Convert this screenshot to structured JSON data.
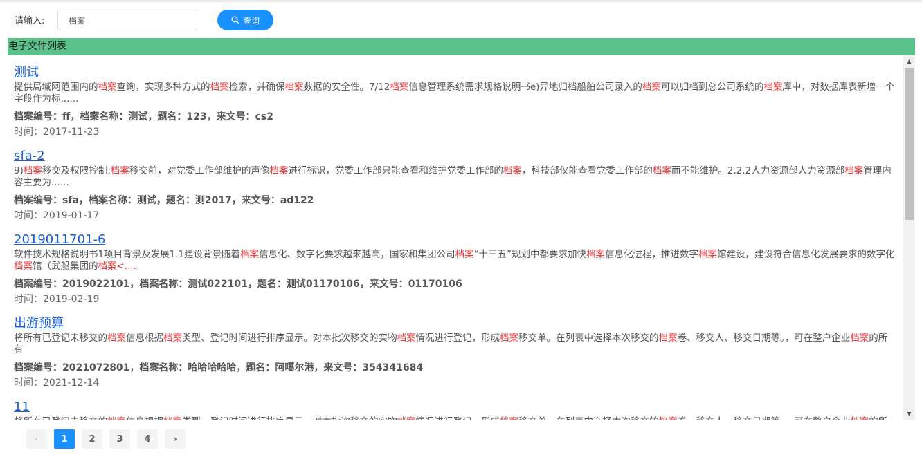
{
  "search": {
    "label": "请输入:",
    "value": "档案",
    "button_label": "查询"
  },
  "list": {
    "header": "电子文件列表",
    "items": [
      {
        "title": "测试",
        "snippet": [
          {
            "t": "提供局域网范围内的"
          },
          {
            "t": "档案",
            "hl": true
          },
          {
            "t": "查询，实现多种方式的"
          },
          {
            "t": "档案",
            "hl": true
          },
          {
            "t": "检索，并确保"
          },
          {
            "t": "档案",
            "hl": true
          },
          {
            "t": "数据的安全性。7/12"
          },
          {
            "t": "档案",
            "hl": true
          },
          {
            "t": "信息管理系统需求规格说明书e)异地归档船舶公司录入的"
          },
          {
            "t": "档案",
            "hl": true
          },
          {
            "t": "可以归档到总公司系统的"
          },
          {
            "t": "档案",
            "hl": true
          },
          {
            "t": "库中，对数据库表新增一个字段作为标......"
          }
        ],
        "meta": "档案编号：ff，档案名称：测试，题名：123，来文号：cs2",
        "time": "时间：2017-11-23"
      },
      {
        "title": "sfa-2",
        "snippet": [
          {
            "t": "9)"
          },
          {
            "t": "档案",
            "hl": true
          },
          {
            "t": "移交及权限控制:"
          },
          {
            "t": "档案",
            "hl": true
          },
          {
            "t": "移交前，对党委工作部维护的声像"
          },
          {
            "t": "档案",
            "hl": true
          },
          {
            "t": "进行标识，党委工作部只能查看和维护党委工作部的"
          },
          {
            "t": "档案",
            "hl": true
          },
          {
            "t": "，科技部仅能查看党委工作部的"
          },
          {
            "t": "档案",
            "hl": true
          },
          {
            "t": "而不能维护。2.2.2人力资源部人力资源部"
          },
          {
            "t": "档案",
            "hl": true
          },
          {
            "t": "管理内容主要为......"
          }
        ],
        "meta": "档案编号：sfa，档案名称：测试，题名：测2017，来文号：ad122",
        "time": "时间：2019-01-17"
      },
      {
        "title": "2019011701-6",
        "snippet": [
          {
            "t": "软件技术规格说明书1项目背景及发展1.1建设背景随着"
          },
          {
            "t": "档案",
            "hl": true
          },
          {
            "t": "信息化、数字化要求越来越高，国家和集团公司"
          },
          {
            "t": "档案",
            "hl": true
          },
          {
            "t": "“十三五”规划中都要求加快"
          },
          {
            "t": "档案",
            "hl": true
          },
          {
            "t": "信息化进程，推进数字"
          },
          {
            "t": "档案",
            "hl": true
          },
          {
            "t": "馆建设，建设符合信息化发展要求的数字化"
          },
          {
            "t": "档案",
            "hl": true
          },
          {
            "t": "馆（武船集团的"
          },
          {
            "t": "档案<.....",
            "hl": true
          }
        ],
        "meta": "档案编号：2019022101，档案名称：测试022101，题名：测试01170106，来文号：01170106",
        "time": "时间：2019-02-19"
      },
      {
        "title": "出游预算",
        "snippet": [
          {
            "t": "将所有已登记未移交的"
          },
          {
            "t": "档案",
            "hl": true
          },
          {
            "t": "信息根据"
          },
          {
            "t": "档案",
            "hl": true
          },
          {
            "t": "类型、登记时间进行排序显示。对本批次移交的实物"
          },
          {
            "t": "档案",
            "hl": true
          },
          {
            "t": "情况进行登记，形成"
          },
          {
            "t": "档案",
            "hl": true
          },
          {
            "t": "移交单。在列表中选择本次移交的"
          },
          {
            "t": "档案",
            "hl": true
          },
          {
            "t": "卷、移交人、移交日期等。，可在整户企业"
          },
          {
            "t": "档案",
            "hl": true
          },
          {
            "t": "的所有"
          }
        ],
        "meta": "档案编号：2021072801，档案名称：哈哈哈哈哈，题名：阿噶尔港，来文号：354341684",
        "time": "时间：2021-12-14"
      },
      {
        "title": "11",
        "snippet": [
          {
            "t": "将所有已登记未移交的"
          },
          {
            "t": "档案",
            "hl": true
          },
          {
            "t": "信息根据"
          },
          {
            "t": "档案",
            "hl": true
          },
          {
            "t": "类型、登记时间进行排序显示。对本批次移交的实物"
          },
          {
            "t": "档案",
            "hl": true
          },
          {
            "t": "情况进行登记，形成"
          },
          {
            "t": "档案",
            "hl": true
          },
          {
            "t": "移交单。在列表中选择本次移交的"
          },
          {
            "t": "档案",
            "hl": true
          },
          {
            "t": "卷、移交人、移交日期等。，可在整户企业"
          },
          {
            "t": "档案",
            "hl": true
          },
          {
            "t": "的所有"
          }
        ],
        "meta": "",
        "time": ""
      }
    ]
  },
  "pagination": {
    "prev": "‹",
    "next": "›",
    "pages": [
      "1",
      "2",
      "3",
      "4"
    ],
    "current": "1"
  },
  "colors": {
    "accent": "#1890ff",
    "header_bg": "#5bc28b",
    "highlight": "#e4393c",
    "link": "#1a5fd8"
  }
}
